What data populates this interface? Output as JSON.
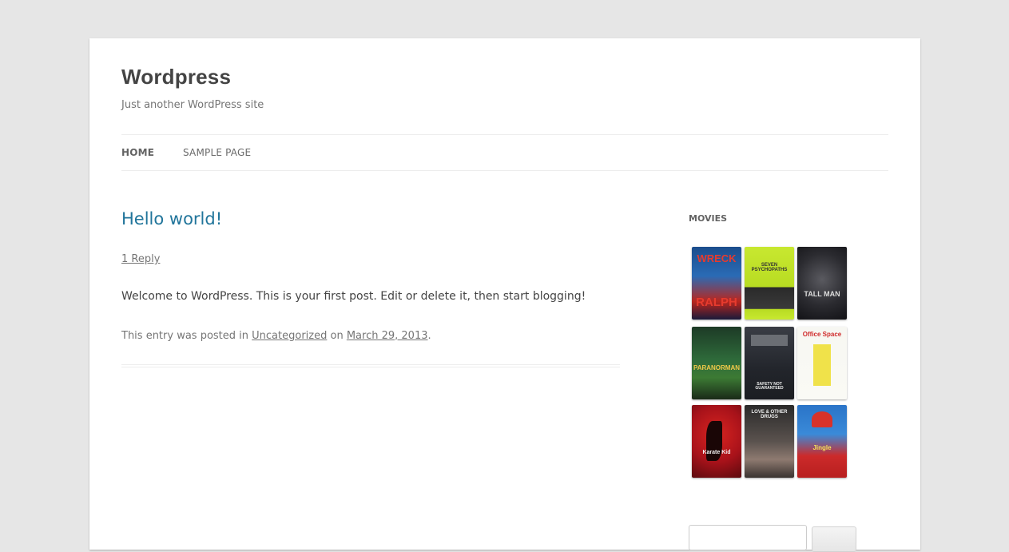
{
  "site": {
    "title": "Wordpress",
    "description": "Just another WordPress site"
  },
  "nav": {
    "items": [
      {
        "label": "HOME",
        "current": true
      },
      {
        "label": "SAMPLE PAGE",
        "current": false
      }
    ]
  },
  "post": {
    "title": "Hello world!",
    "reply_link": "1 Reply",
    "content": "Welcome to WordPress. This is your first post. Edit or delete it, then start blogging!",
    "meta_prefix": "This entry was posted in ",
    "category": "Uncategorized",
    "meta_on": " on ",
    "date": "March 29, 2013",
    "meta_suffix": "."
  },
  "sidebar": {
    "widget_title": "MOVIES",
    "posters": [
      {
        "name": "Wreck-It Ralph",
        "lettering": "WRECK-IT RALPH"
      },
      {
        "name": "Seven Psychopaths",
        "lettering": "SEVEN PSYCHOPATHS"
      },
      {
        "name": "The Tall Man",
        "lettering": "TALL MAN"
      },
      {
        "name": "ParaNorman",
        "lettering": "PARANORMAN"
      },
      {
        "name": "Safety Not Guaranteed",
        "lettering": "SAFETY NOT GUARANTEED"
      },
      {
        "name": "Office Space",
        "lettering": "Office Space"
      },
      {
        "name": "The Karate Kid",
        "lettering": "The Karate Kid"
      },
      {
        "name": "Love & Other Drugs",
        "lettering": "LOVE & OTHER DRUGS"
      },
      {
        "name": "Jingle All the Way",
        "lettering": "Jingle All the Way"
      }
    ]
  },
  "colors": {
    "link": "#21759b",
    "text": "#444444",
    "meta": "#757575",
    "background": "#e6e6e6"
  }
}
